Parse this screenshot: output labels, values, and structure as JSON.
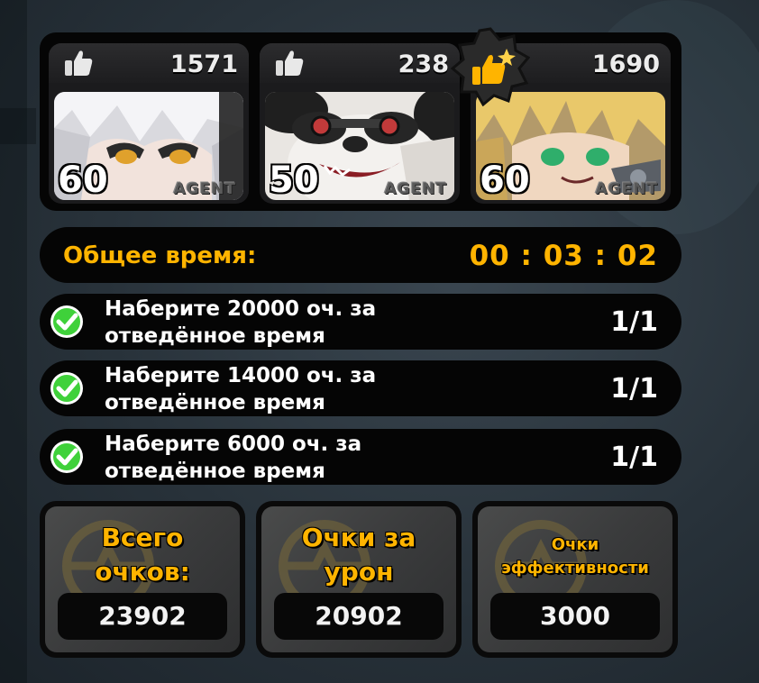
{
  "agents": [
    {
      "likes": "1571",
      "level": "60",
      "tag": "AGENT",
      "mvp": false,
      "portrait": "white-haired-girl-portrait"
    },
    {
      "likes": "238",
      "level": "50",
      "tag": "AGENT",
      "mvp": false,
      "portrait": "panda-portrait"
    },
    {
      "likes": "1690",
      "level": "60",
      "tag": "AGENT",
      "mvp": true,
      "portrait": "blonde-agent-portrait"
    }
  ],
  "time": {
    "label": "Общее время:",
    "value": "00 : 03 : 02"
  },
  "tasks": [
    {
      "line1": "Наберите 20000 оч. за",
      "line2": "отведённое время",
      "progress": "1/1",
      "done": true
    },
    {
      "line1": "Наберите 14000 оч. за",
      "line2": "отведённое время",
      "progress": "1/1",
      "done": true
    },
    {
      "line1": "Наберите 6000 оч. за",
      "line2": "отведённое время",
      "progress": "1/1",
      "done": true
    }
  ],
  "scores": [
    {
      "line1": "Всего",
      "line2": "очков:",
      "value": "23902"
    },
    {
      "line1": "Очки за",
      "line2": "урон",
      "value": "20902"
    },
    {
      "line1": "Очки",
      "line2": "эффективности",
      "value": "3000"
    }
  ],
  "colors": {
    "accent": "#ffb400",
    "check_green": "#3fd13a",
    "panel": "#050505"
  },
  "icons": {
    "like": "thumbs-up-icon",
    "mvp": "thumbs-up-star-icon",
    "task_done": "check-circle-icon"
  }
}
